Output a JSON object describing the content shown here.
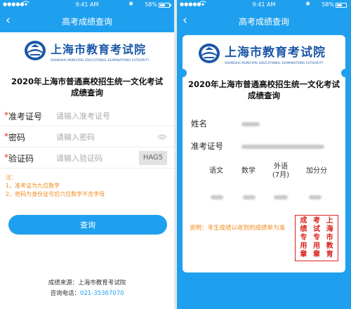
{
  "status_bar": {
    "time": "9:41 AM",
    "battery_percent": "58%",
    "battery_level": 0.58,
    "signal_glyph": "●●●●●",
    "wifi_icon": "wifi-icon",
    "bluetooth_icon": "bluetooth-icon"
  },
  "left": {
    "nav": {
      "title": "高考成绩查询",
      "back_glyph": "‹"
    },
    "logo": {
      "name_cn": "上海市教育考试院",
      "name_en": "SHANGHAI MUNICIPAL EDUCATIONAL EXAMINATIONS AUTHORITY"
    },
    "heading_line1": "2020年上海市普通高校招生统一文化考试",
    "heading_line2": "成绩查询",
    "form": {
      "required_mark": "*",
      "ticket_label": "准考证号",
      "ticket_placeholder": "请输入准考证号",
      "password_label": "密码",
      "password_placeholder": "请输入密码",
      "captcha_label": "验证码",
      "captcha_placeholder": "请输入验证码",
      "captcha_code": "HAG5"
    },
    "notes": {
      "title": "注：",
      "line1": "1、准考证为九位数字",
      "line2": "2、密码为身份证号后六位数字不含字母"
    },
    "query_button": "查询",
    "footer": {
      "source": "成绩来源：上海市教育考试院",
      "phone_label": "咨询电话：",
      "phone": "021-35367070"
    }
  },
  "right": {
    "nav": {
      "title": "高考成绩查询",
      "back_glyph": "‹"
    },
    "logo": {
      "name_cn": "上海市教育考试院",
      "name_en": "SHANGHAI MUNICIPAL EDUCATIONAL EXAMINATIONS AUTHORITY"
    },
    "heading_line1": "2020年上海市普通高校招生统一文化考试",
    "heading_line2": "成绩查询",
    "name_label": "姓名",
    "ticket_label": "准考证号",
    "subjects": {
      "chinese": "语文",
      "math": "数学",
      "foreign_line1": "外语",
      "foreign_line2": "(7月)",
      "bonus": "加分分"
    },
    "remark": "说明：考生成绩以收到的成绩单为准",
    "stamp": {
      "col1": [
        "成",
        "绩",
        "专",
        "用",
        "章"
      ],
      "col2": [
        "考",
        "试",
        "专",
        "用",
        "章"
      ],
      "col3": [
        "上",
        "海",
        "市",
        "教",
        "育"
      ]
    }
  },
  "colors": {
    "primary": "#1fa0ee",
    "logo_blue": "#1b57a8",
    "required_red": "#e0302a",
    "note_orange": "#f08a1c",
    "stamp_red": "#d9221d"
  }
}
